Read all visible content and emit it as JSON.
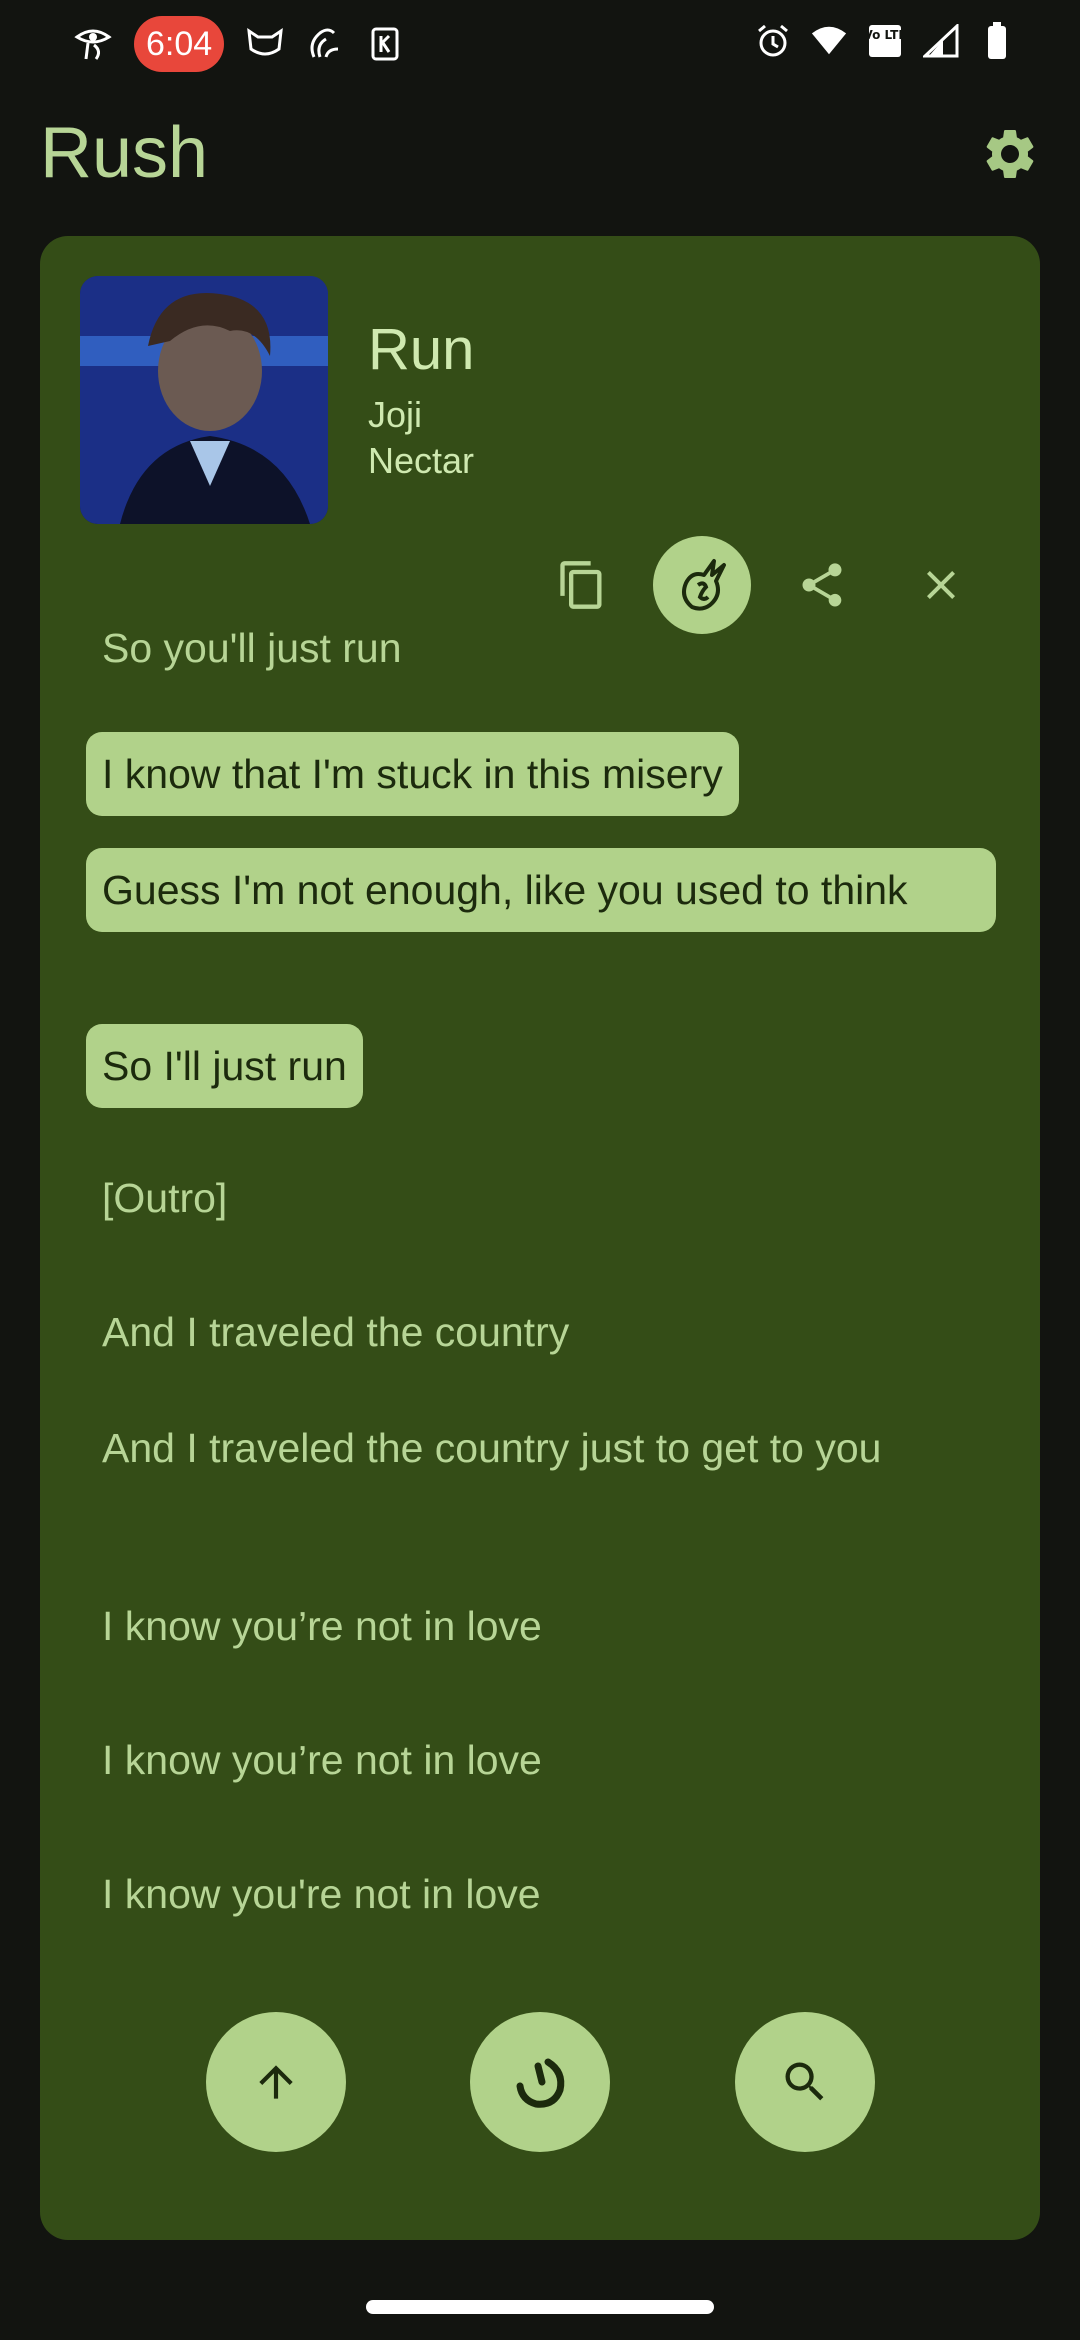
{
  "status_bar": {
    "time": "6:04",
    "left_icons": [
      "eye-of-horus-icon",
      "mask-icon",
      "gnome-icon",
      "card-icon"
    ],
    "right_icons": [
      "alarm-icon",
      "wifi-icon",
      "volte-icon",
      "signal-icon",
      "battery-icon"
    ],
    "volte_label": "Vo LTE"
  },
  "app": {
    "title": "Rush"
  },
  "song": {
    "title": "Run",
    "artist": "Joji",
    "album": "Nectar"
  },
  "actions": [
    {
      "name": "copy-icon",
      "active": false
    },
    {
      "name": "genius-icon",
      "active": true
    },
    {
      "name": "share-icon",
      "active": false
    },
    {
      "name": "close-icon",
      "active": false
    }
  ],
  "lyrics": [
    {
      "text": "So you'll just run",
      "selected": false
    },
    {
      "text": "I know that I'm stuck in this misery",
      "selected": true
    },
    {
      "text": "Guess I'm not enough, like you used to think",
      "selected": true
    },
    {
      "text": "So I'll just run",
      "selected": true
    },
    {
      "text": "[Outro]",
      "selected": false
    },
    {
      "text": "And I traveled the country",
      "selected": false
    },
    {
      "text": "And I traveled the country just to get to you",
      "selected": false
    },
    {
      "text": "I know you’re not in love",
      "selected": false
    },
    {
      "text": "I know you’re not in love",
      "selected": false
    },
    {
      "text": "I know you're not in love",
      "selected": false
    }
  ],
  "bottom_buttons": [
    "arrow-up-icon",
    "sync-icon",
    "search-icon"
  ],
  "colors": {
    "background": "#121410",
    "card": "#344d17",
    "accent": "#b1d28a",
    "text": "#b7d596",
    "time_pill": "#e8473b"
  }
}
